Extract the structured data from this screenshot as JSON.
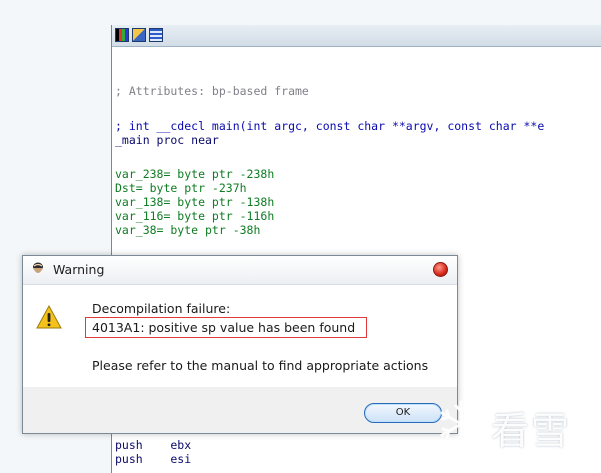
{
  "ida": {
    "code_lines": [
      {
        "text": "; Attributes: bp-based frame",
        "color": "gray"
      },
      {
        "text": "; int __cdecl main(int argc, const char **argv, const char **e",
        "color": "blue"
      },
      {
        "text": "_main proc near",
        "color": "navy"
      },
      {
        "text": "var_238= byte ptr -238h",
        "color": "green"
      },
      {
        "text": "Dst= byte ptr -237h",
        "color": "green"
      },
      {
        "text": "var_138= byte ptr -138h",
        "color": "green"
      },
      {
        "text": "var_116= byte ptr -116h",
        "color": "green"
      },
      {
        "text": "var_38= byte ptr -38h",
        "color": "green"
      },
      {
        "text": "push    ebx",
        "color": "navy"
      },
      {
        "text": "push    esi",
        "color": "navy"
      }
    ]
  },
  "dialog": {
    "title": "Warning",
    "message_title": "Decompilation failure:",
    "message_detail": "4013A1: positive sp value has been found",
    "message_hint": "Please refer to the manual to find appropriate actions",
    "ok_label": "OK"
  },
  "watermark": {
    "text": "看雪"
  },
  "colors": {
    "highlight_box": "#e03a3a",
    "code_comment": "#80808a",
    "code_blue": "#0a0ab0",
    "code_green": "#0f7c23"
  },
  "icons": [
    "graph-view-icon",
    "edit-icon",
    "list-view-icon",
    "app-icon",
    "close-icon",
    "warning-icon",
    "snowflake-icon"
  ]
}
